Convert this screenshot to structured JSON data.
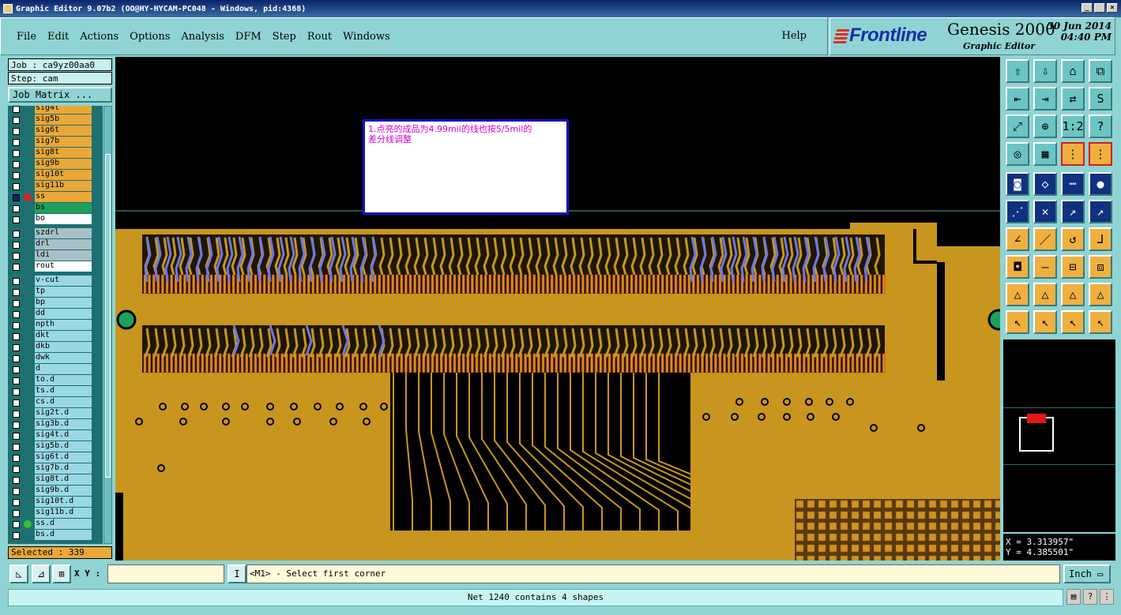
{
  "window": {
    "title": "Graphic Editor 9.07b2 (OO@HY-HYCAM-PC048 - Windows, pid:4368)",
    "buttons": [
      "_",
      " ",
      "×"
    ]
  },
  "menu": {
    "items": [
      "File",
      "Edit",
      "Actions",
      "Options",
      "Analysis",
      "DFM",
      "Step",
      "Rout",
      "Windows"
    ],
    "help": "Help"
  },
  "brand": {
    "logo": "Frontline",
    "product": "Genesis 2000",
    "subtitle": "Graphic Editor",
    "date": "30 Jun 2014",
    "time": "04:40 PM"
  },
  "left_panel": {
    "job": "Job : ca9yz00aa0",
    "step": "Step: cam",
    "job_matrix": "Job Matrix ...",
    "selected": "Selected : 339",
    "layers": [
      {
        "name": "sig4t",
        "type": "sig"
      },
      {
        "name": "sig5b",
        "type": "sig"
      },
      {
        "name": "sig6t",
        "type": "sig"
      },
      {
        "name": "sig7b",
        "type": "sig"
      },
      {
        "name": "sig8t",
        "type": "sig"
      },
      {
        "name": "sig9b",
        "type": "sig"
      },
      {
        "name": "sig10t",
        "type": "sig"
      },
      {
        "name": "sig11b",
        "type": "sig"
      },
      {
        "name": "ss",
        "type": "sig"
      },
      {
        "name": "bs",
        "type": "gr"
      },
      {
        "name": "bo",
        "type": "wh"
      },
      {
        "name": "szdrl",
        "type": "dr"
      },
      {
        "name": "drl",
        "type": "dr"
      },
      {
        "name": "ldi",
        "type": "dr"
      },
      {
        "name": "rout",
        "type": "wh"
      },
      {
        "name": "v-cut",
        "type": "doc"
      },
      {
        "name": "tp",
        "type": "doc"
      },
      {
        "name": "bp",
        "type": "doc"
      },
      {
        "name": "dd",
        "type": "doc"
      },
      {
        "name": "npth",
        "type": "doc"
      },
      {
        "name": "dkt",
        "type": "doc"
      },
      {
        "name": "dkb",
        "type": "doc"
      },
      {
        "name": "dwk",
        "type": "doc"
      },
      {
        "name": "d",
        "type": "doc"
      },
      {
        "name": "to.d",
        "type": "doc"
      },
      {
        "name": "ts.d",
        "type": "doc"
      },
      {
        "name": "cs.d",
        "type": "doc"
      },
      {
        "name": "sig2t.d",
        "type": "doc"
      },
      {
        "name": "sig3b.d",
        "type": "doc"
      },
      {
        "name": "sig4t.d",
        "type": "doc"
      },
      {
        "name": "sig5b.d",
        "type": "doc"
      },
      {
        "name": "sig6t.d",
        "type": "doc"
      },
      {
        "name": "sig7b.d",
        "type": "doc"
      },
      {
        "name": "sig8t.d",
        "type": "doc"
      },
      {
        "name": "sig9b.d",
        "type": "doc"
      },
      {
        "name": "sig10t.d",
        "type": "doc"
      },
      {
        "name": "sig11b.d",
        "type": "doc"
      },
      {
        "name": "ss.d",
        "type": "doc"
      },
      {
        "name": "bs.d",
        "type": "doc"
      }
    ]
  },
  "canvas": {
    "note_line1": "1.点亮的成品为4.99mil的线也按5/5mil的",
    "note_line2": "差分线调整",
    "colors": {
      "copper": "#c8961e",
      "trace_outline": "#d03010",
      "diff_pair": "#6c78e8",
      "background": "#000000"
    }
  },
  "tools": {
    "icons": [
      "up-arrow-box",
      "down-arrow-box",
      "home-box",
      "corner-box",
      "left-in",
      "right-in",
      "swap",
      "s-curve",
      "expand",
      "center",
      "ratio",
      "help",
      "stamp",
      "grid",
      "net-a",
      "net-b",
      "snapshot",
      "polygon",
      "ruler",
      "pad",
      "connect",
      "cross",
      "segment",
      "arc",
      "angle-line",
      "line",
      "rotate",
      "flip",
      "move-pad",
      "dash",
      "resize",
      "group",
      "triangle-a",
      "triangle-b",
      "triangle-c",
      "triangle-d",
      "pointer-a",
      "pointer-b",
      "pointer-c",
      "pointer-d"
    ],
    "ratio_label": "1:2",
    "help_label": "?"
  },
  "coords": {
    "x": "X = 3.313957\"",
    "y": "Y = 4.385501\""
  },
  "command": {
    "xy_label": "X Y :",
    "xy_value": "",
    "prompt": "<M1> - Select first corner",
    "units": "Inch"
  },
  "status": {
    "message": "Net 1240 contains 4 shapes"
  }
}
